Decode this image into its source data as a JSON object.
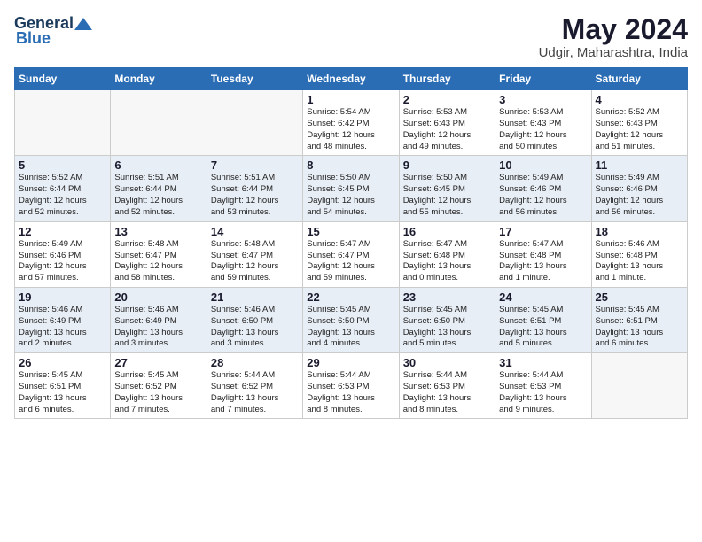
{
  "logo": {
    "general": "General",
    "blue": "Blue"
  },
  "title": {
    "month_year": "May 2024",
    "location": "Udgir, Maharashtra, India"
  },
  "weekdays": [
    "Sunday",
    "Monday",
    "Tuesday",
    "Wednesday",
    "Thursday",
    "Friday",
    "Saturday"
  ],
  "weeks": [
    [
      {
        "num": "",
        "detail": ""
      },
      {
        "num": "",
        "detail": ""
      },
      {
        "num": "",
        "detail": ""
      },
      {
        "num": "1",
        "detail": "Sunrise: 5:54 AM\nSunset: 6:42 PM\nDaylight: 12 hours\nand 48 minutes."
      },
      {
        "num": "2",
        "detail": "Sunrise: 5:53 AM\nSunset: 6:43 PM\nDaylight: 12 hours\nand 49 minutes."
      },
      {
        "num": "3",
        "detail": "Sunrise: 5:53 AM\nSunset: 6:43 PM\nDaylight: 12 hours\nand 50 minutes."
      },
      {
        "num": "4",
        "detail": "Sunrise: 5:52 AM\nSunset: 6:43 PM\nDaylight: 12 hours\nand 51 minutes."
      }
    ],
    [
      {
        "num": "5",
        "detail": "Sunrise: 5:52 AM\nSunset: 6:44 PM\nDaylight: 12 hours\nand 52 minutes."
      },
      {
        "num": "6",
        "detail": "Sunrise: 5:51 AM\nSunset: 6:44 PM\nDaylight: 12 hours\nand 52 minutes."
      },
      {
        "num": "7",
        "detail": "Sunrise: 5:51 AM\nSunset: 6:44 PM\nDaylight: 12 hours\nand 53 minutes."
      },
      {
        "num": "8",
        "detail": "Sunrise: 5:50 AM\nSunset: 6:45 PM\nDaylight: 12 hours\nand 54 minutes."
      },
      {
        "num": "9",
        "detail": "Sunrise: 5:50 AM\nSunset: 6:45 PM\nDaylight: 12 hours\nand 55 minutes."
      },
      {
        "num": "10",
        "detail": "Sunrise: 5:49 AM\nSunset: 6:46 PM\nDaylight: 12 hours\nand 56 minutes."
      },
      {
        "num": "11",
        "detail": "Sunrise: 5:49 AM\nSunset: 6:46 PM\nDaylight: 12 hours\nand 56 minutes."
      }
    ],
    [
      {
        "num": "12",
        "detail": "Sunrise: 5:49 AM\nSunset: 6:46 PM\nDaylight: 12 hours\nand 57 minutes."
      },
      {
        "num": "13",
        "detail": "Sunrise: 5:48 AM\nSunset: 6:47 PM\nDaylight: 12 hours\nand 58 minutes."
      },
      {
        "num": "14",
        "detail": "Sunrise: 5:48 AM\nSunset: 6:47 PM\nDaylight: 12 hours\nand 59 minutes."
      },
      {
        "num": "15",
        "detail": "Sunrise: 5:47 AM\nSunset: 6:47 PM\nDaylight: 12 hours\nand 59 minutes."
      },
      {
        "num": "16",
        "detail": "Sunrise: 5:47 AM\nSunset: 6:48 PM\nDaylight: 13 hours\nand 0 minutes."
      },
      {
        "num": "17",
        "detail": "Sunrise: 5:47 AM\nSunset: 6:48 PM\nDaylight: 13 hours\nand 1 minute."
      },
      {
        "num": "18",
        "detail": "Sunrise: 5:46 AM\nSunset: 6:48 PM\nDaylight: 13 hours\nand 1 minute."
      }
    ],
    [
      {
        "num": "19",
        "detail": "Sunrise: 5:46 AM\nSunset: 6:49 PM\nDaylight: 13 hours\nand 2 minutes."
      },
      {
        "num": "20",
        "detail": "Sunrise: 5:46 AM\nSunset: 6:49 PM\nDaylight: 13 hours\nand 3 minutes."
      },
      {
        "num": "21",
        "detail": "Sunrise: 5:46 AM\nSunset: 6:50 PM\nDaylight: 13 hours\nand 3 minutes."
      },
      {
        "num": "22",
        "detail": "Sunrise: 5:45 AM\nSunset: 6:50 PM\nDaylight: 13 hours\nand 4 minutes."
      },
      {
        "num": "23",
        "detail": "Sunrise: 5:45 AM\nSunset: 6:50 PM\nDaylight: 13 hours\nand 5 minutes."
      },
      {
        "num": "24",
        "detail": "Sunrise: 5:45 AM\nSunset: 6:51 PM\nDaylight: 13 hours\nand 5 minutes."
      },
      {
        "num": "25",
        "detail": "Sunrise: 5:45 AM\nSunset: 6:51 PM\nDaylight: 13 hours\nand 6 minutes."
      }
    ],
    [
      {
        "num": "26",
        "detail": "Sunrise: 5:45 AM\nSunset: 6:51 PM\nDaylight: 13 hours\nand 6 minutes."
      },
      {
        "num": "27",
        "detail": "Sunrise: 5:45 AM\nSunset: 6:52 PM\nDaylight: 13 hours\nand 7 minutes."
      },
      {
        "num": "28",
        "detail": "Sunrise: 5:44 AM\nSunset: 6:52 PM\nDaylight: 13 hours\nand 7 minutes."
      },
      {
        "num": "29",
        "detail": "Sunrise: 5:44 AM\nSunset: 6:53 PM\nDaylight: 13 hours\nand 8 minutes."
      },
      {
        "num": "30",
        "detail": "Sunrise: 5:44 AM\nSunset: 6:53 PM\nDaylight: 13 hours\nand 8 minutes."
      },
      {
        "num": "31",
        "detail": "Sunrise: 5:44 AM\nSunset: 6:53 PM\nDaylight: 13 hours\nand 9 minutes."
      },
      {
        "num": "",
        "detail": ""
      }
    ]
  ]
}
